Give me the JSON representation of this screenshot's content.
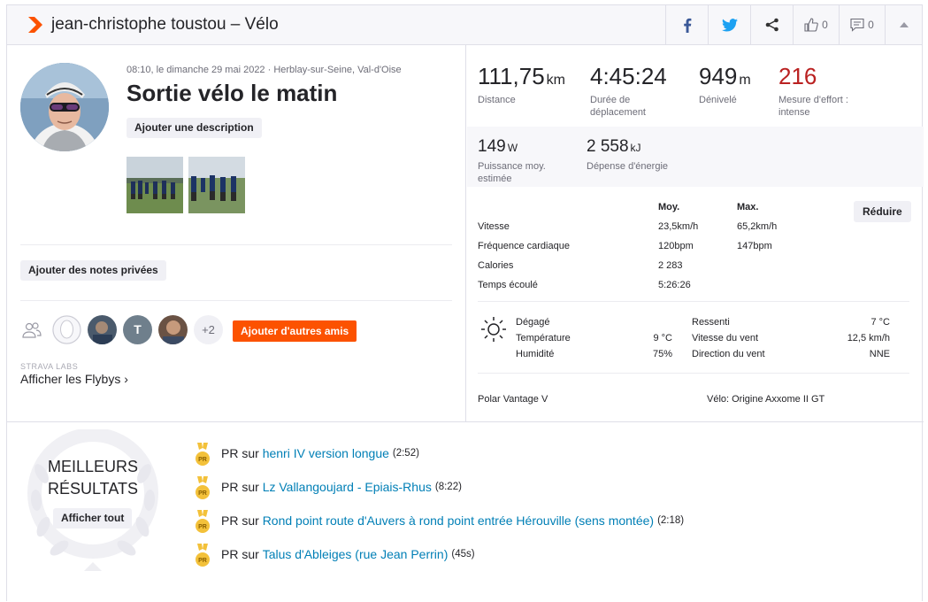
{
  "header": {
    "title": "jean-christophe toustou – Vélo",
    "kudos_count": "0",
    "comment_count": "0"
  },
  "left": {
    "meta": "08:10, le dimanche 29 mai 2022 · Herblay-sur-Seine, Val-d'Oise",
    "activity_name": "Sortie vélo le matin",
    "add_description": "Ajouter une description",
    "add_private_notes": "Ajouter des notes privées",
    "athlete_t_initial": "T",
    "more_athletes": "+2",
    "add_friends": "Ajouter d'autres amis",
    "labs": "STRAVA LABS",
    "flyby": "Afficher les Flybys ›"
  },
  "stats": {
    "distance": {
      "value": "111,75",
      "unit": "km",
      "label": "Distance"
    },
    "moving_time": {
      "value": "4:45:24",
      "label": "Durée de déplacement"
    },
    "elevation": {
      "value": "949",
      "unit": "m",
      "label": "Dénivelé"
    },
    "effort": {
      "value": "216",
      "label": "Mesure d'effort : intense"
    },
    "power": {
      "value": "149",
      "unit": "W",
      "label": "Puissance moy. estimée"
    },
    "energy": {
      "value": "2 558",
      "unit": "kJ",
      "label": "Dépense d'énergie"
    }
  },
  "details": {
    "col_avg": "Moy.",
    "col_max": "Max.",
    "reduce": "Réduire",
    "rows": [
      {
        "label": "Vitesse",
        "avg": "23,5km/h",
        "max": "65,2km/h"
      },
      {
        "label": "Fréquence cardiaque",
        "avg": "120bpm",
        "max": "147bpm"
      },
      {
        "label": "Calories",
        "avg": "2 283",
        "max": ""
      },
      {
        "label": "Temps écoulé",
        "avg": "5:26:26",
        "max": ""
      }
    ]
  },
  "weather": {
    "condition": "Dégagé",
    "temp_label": "Température",
    "temp_value": "9 °C",
    "humidity_label": "Humidité",
    "humidity_value": "75%",
    "feels_label": "Ressenti",
    "feels_value": "7 °C",
    "wind_label": "Vitesse du vent",
    "wind_value": "12,5 km/h",
    "dir_label": "Direction du vent",
    "dir_value": "NNE"
  },
  "device": "Polar Vantage V",
  "bike": "Vélo: Origine Axxome II GT",
  "best": {
    "title_line1": "MEILLEURS",
    "title_line2": "RÉSULTATS",
    "view_all": "Afficher tout",
    "pr_label": "PR",
    "pr_on": "sur",
    "medal_text": "PR",
    "items": [
      {
        "segment": "henri IV version longue",
        "time": "(2:52)"
      },
      {
        "segment": "Lz Vallangoujard - Epiais-Rhus",
        "time": "(8:22)"
      },
      {
        "segment": "Rond point route d'Auvers à rond point entrée Hérouville (sens montée)",
        "time": "(2:18)"
      },
      {
        "segment": "Talus d'Ableiges (rue Jean Perrin)",
        "time": "(45s)"
      }
    ]
  },
  "colors": {
    "brand": "#fc5200",
    "link": "#007fb6",
    "effort": "#ba2121",
    "medal": "#f3c13a"
  }
}
